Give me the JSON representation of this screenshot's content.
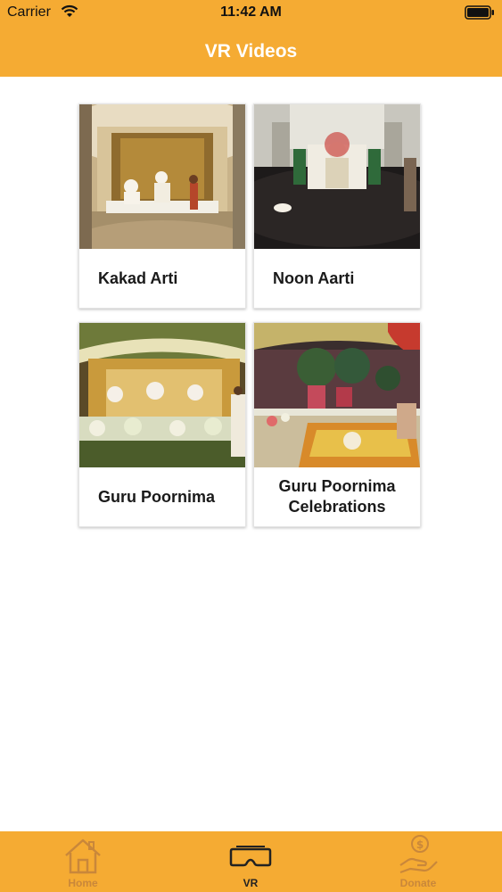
{
  "status_bar": {
    "carrier": "Carrier",
    "time": "11:42 AM"
  },
  "nav": {
    "title": "VR Videos"
  },
  "videos": [
    {
      "title": "Kakad Arti"
    },
    {
      "title": "Noon Aarti"
    },
    {
      "title": "Guru Poornima"
    },
    {
      "title": "Guru Poornima Celebrations"
    }
  ],
  "tabs": [
    {
      "label": "Home",
      "icon": "home-icon"
    },
    {
      "label": "VR",
      "icon": "vr-headset-icon",
      "selected": true
    },
    {
      "label": "Donate",
      "icon": "donate-icon"
    }
  ],
  "colors": {
    "accent": "#f5ab33",
    "tab_active": "#222222",
    "tab_inactive": "#c9873a"
  }
}
